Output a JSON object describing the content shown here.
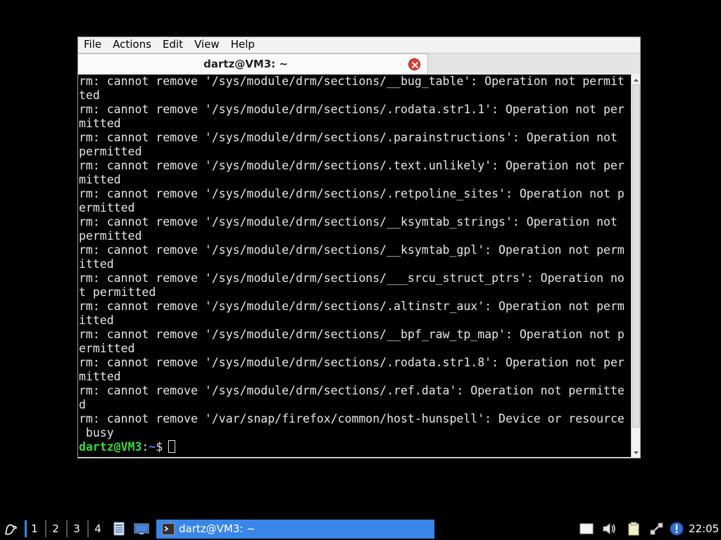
{
  "window": {
    "menu": [
      "File",
      "Actions",
      "Edit",
      "View",
      "Help"
    ],
    "tab_title": "dartz@VM3: ~"
  },
  "terminal": {
    "lines": [
      "rm: cannot remove '/sys/module/drm/sections/__bug_table': Operation not permit",
      "ted",
      "rm: cannot remove '/sys/module/drm/sections/.rodata.str1.1': Operation not per",
      "mitted",
      "rm: cannot remove '/sys/module/drm/sections/.parainstructions': Operation not ",
      "permitted",
      "rm: cannot remove '/sys/module/drm/sections/.text.unlikely': Operation not per",
      "mitted",
      "rm: cannot remove '/sys/module/drm/sections/.retpoline_sites': Operation not p",
      "ermitted",
      "rm: cannot remove '/sys/module/drm/sections/__ksymtab_strings': Operation not ",
      "permitted",
      "rm: cannot remove '/sys/module/drm/sections/__ksymtab_gpl': Operation not perm",
      "itted",
      "rm: cannot remove '/sys/module/drm/sections/___srcu_struct_ptrs': Operation no",
      "t permitted",
      "rm: cannot remove '/sys/module/drm/sections/.altinstr_aux': Operation not perm",
      "itted",
      "rm: cannot remove '/sys/module/drm/sections/__bpf_raw_tp_map': Operation not p",
      "ermitted",
      "rm: cannot remove '/sys/module/drm/sections/.rodata.str1.8': Operation not per",
      "mitted",
      "rm: cannot remove '/sys/module/drm/sections/.ref.data': Operation not permitte",
      "d",
      "rm: cannot remove '/var/snap/firefox/common/host-hunspell': Device or resource",
      " busy"
    ],
    "prompt_user": "dartz@VM3",
    "prompt_sep": ":",
    "prompt_path": "~",
    "prompt_symbol": "$"
  },
  "taskbar": {
    "workspaces": [
      "1",
      "2",
      "3",
      "4"
    ],
    "task_label": "dartz@VM3: ~",
    "clock": "22:05",
    "accent": "#3a86e8"
  }
}
